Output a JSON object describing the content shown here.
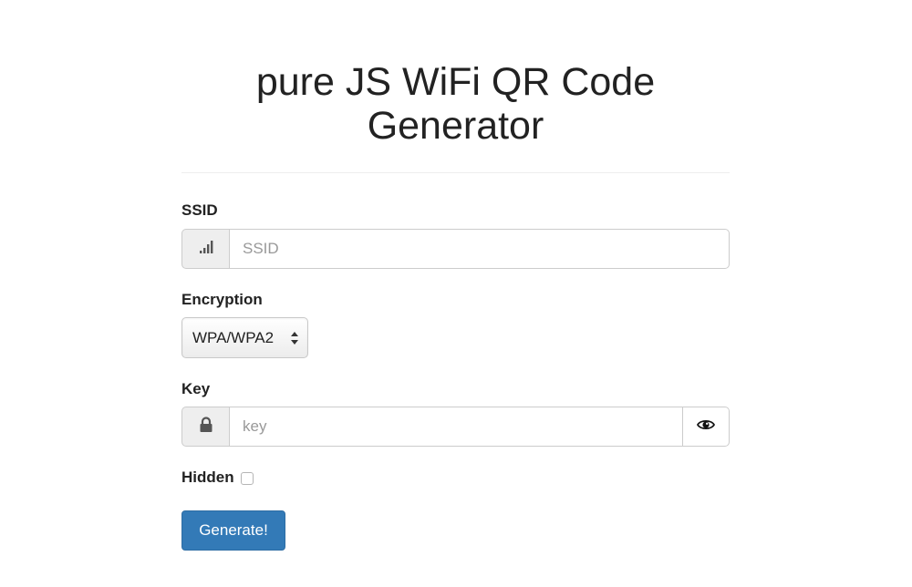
{
  "header": {
    "title_line1": "pure JS WiFi QR Code",
    "title_line2": "Generator"
  },
  "form": {
    "ssid": {
      "label": "SSID",
      "placeholder": "SSID",
      "value": "",
      "icon": "signal-icon"
    },
    "encryption": {
      "label": "Encryption",
      "selected": "WPA/WPA2"
    },
    "key": {
      "label": "Key",
      "placeholder": "key",
      "value": "",
      "icon": "lock-icon",
      "toggle_icon": "eye-icon"
    },
    "hidden": {
      "label": "Hidden",
      "checked": false
    },
    "submit_label": "Generate!"
  },
  "colors": {
    "primary_button": "#337ab7",
    "addon_background": "#eeeeee",
    "border": "#cccccc"
  }
}
